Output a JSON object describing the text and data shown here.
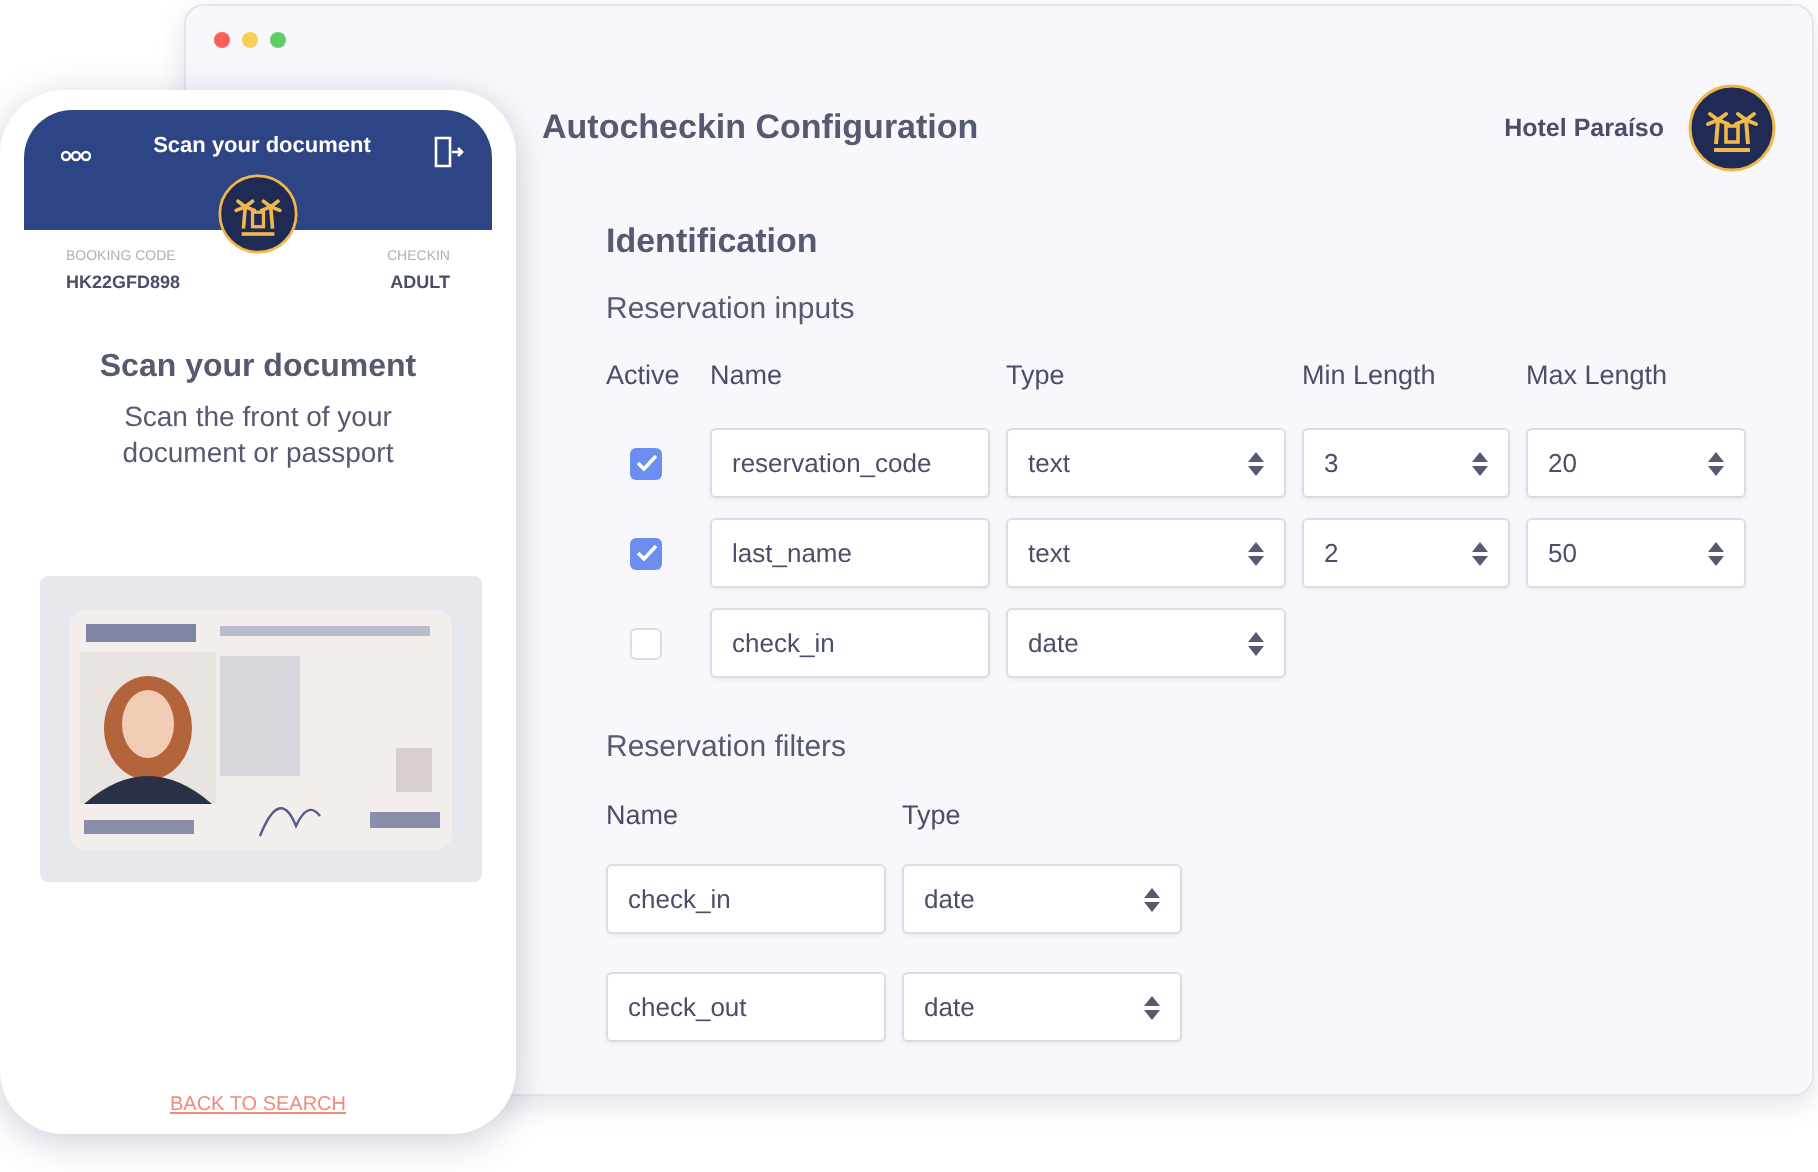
{
  "window": {
    "title": "Autocheckin Configuration",
    "hotel": "Hotel Paraíso"
  },
  "section": "Identification",
  "inputs": {
    "title": "Reservation inputs",
    "columns": [
      "Active",
      "Name",
      "Type",
      "Min Length",
      "Max Length"
    ],
    "rows": [
      {
        "active": true,
        "name": "reservation_code",
        "type": "text",
        "min_length": "3",
        "max_length": "20"
      },
      {
        "active": true,
        "name": "last_name",
        "type": "text",
        "min_length": "2",
        "max_length": "50"
      },
      {
        "active": false,
        "name": "check_in",
        "type": "date"
      }
    ]
  },
  "filters": {
    "title": "Reservation filters",
    "columns": [
      "Name",
      "Type"
    ],
    "rows": [
      {
        "name": "check_in",
        "type": "date"
      },
      {
        "name": "check_out",
        "type": "date"
      }
    ]
  },
  "phone": {
    "title": "Scan your document",
    "booking_label": "BOOKING CODE",
    "booking_code": "HK22GFD898",
    "checkin_label": "CHECKIN",
    "checkin_value": "ADULT",
    "heading": "Scan your document",
    "instructions": "Scan the front of your document or passport",
    "back_link": "BACK TO SEARCH"
  }
}
